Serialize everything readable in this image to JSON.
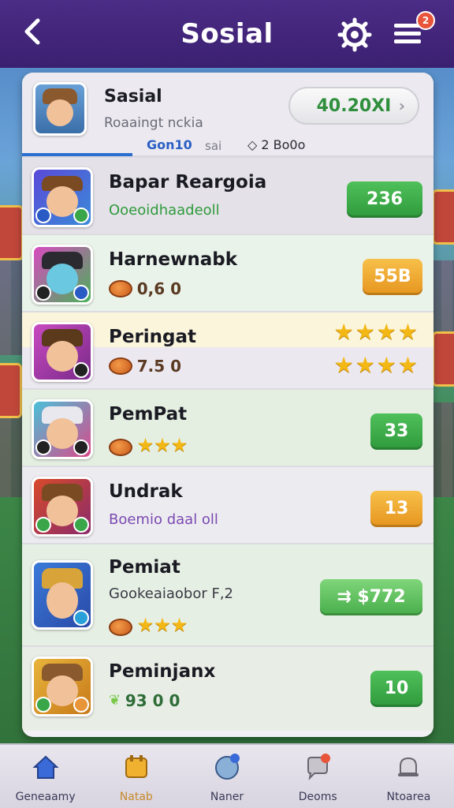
{
  "header": {
    "title": "Sosial",
    "back_icon": "chevron-left-icon",
    "settings_icon": "gear-icon",
    "menu_icon": "list-icon",
    "menu_badge": "2"
  },
  "profile": {
    "name": "Sasial",
    "subtitle": "Roaaingt nckia",
    "currency": "40.20XI",
    "tab_active": "Gon10",
    "tab_mid": "sai",
    "tab_right": "2 Bo0o"
  },
  "rows": [
    {
      "name": "Bapar Reargoia",
      "sub": "Ooeoidhaadeoll",
      "sub_color": "#2f9a3c",
      "score": "236",
      "score_style": "green"
    },
    {
      "name": "Harnewnabk",
      "sub": "0,6 0",
      "score": "55B",
      "score_style": "orange"
    },
    {
      "name": "Peringat",
      "sub": "7.5 0",
      "rating": 4
    },
    {
      "name": "PemPat",
      "score": "33",
      "score_style": "green",
      "rating": 3
    },
    {
      "name": "Undrak",
      "sub": "Boemio daal oll",
      "sub_color": "#7a4ab0",
      "score": "13",
      "score_style": "orange"
    },
    {
      "name": "Pemiat",
      "sub": "Gookeaiaobor F,2",
      "sub_color": "#3a3a44",
      "score": "$772",
      "score_style": "lightgreen",
      "rating": 3
    },
    {
      "name": "Peminjanx",
      "sub": "93 0 0",
      "sub_color": "#2f6d38",
      "score": "10",
      "score_style": "green"
    }
  ],
  "nav": [
    {
      "label": "Geneaamy",
      "icon": "home-icon"
    },
    {
      "label": "Natab",
      "icon": "calendar-icon"
    },
    {
      "label": "Naner",
      "icon": "globe-icon"
    },
    {
      "label": "Deoms",
      "icon": "chat-icon"
    },
    {
      "label": "Ntoarea",
      "icon": "bell-icon"
    }
  ],
  "colors": {
    "header": "#4b2c86",
    "accent_green": "#2f9a3c",
    "accent_orange": "#e6951e"
  }
}
